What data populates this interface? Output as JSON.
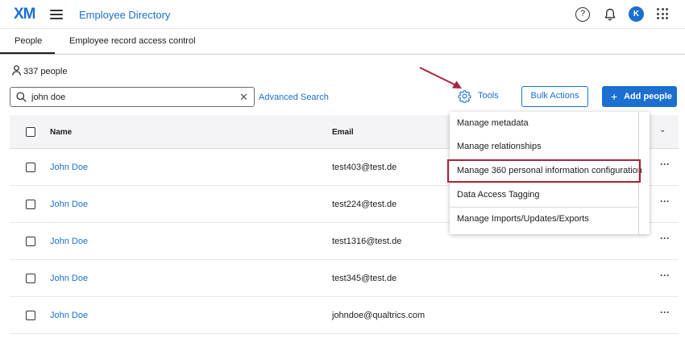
{
  "app": {
    "logo": "XM",
    "title": "Employee Directory",
    "avatar_initial": "K",
    "help_glyph": "?"
  },
  "tabs": [
    {
      "label": "People",
      "active": true
    },
    {
      "label": "Employee record access control",
      "active": false
    }
  ],
  "people_count": "337 people",
  "search": {
    "value": "john doe",
    "clear_glyph": "✕"
  },
  "advanced_search_label": "Advanced Search",
  "toolbar": {
    "tools_label": "Tools",
    "bulk_actions_label": "Bulk Actions",
    "add_people_label": "Add people",
    "add_glyph": "+"
  },
  "table": {
    "columns": {
      "name": "Name",
      "email": "Email",
      "chevron": "⌄"
    },
    "rows": [
      {
        "name": "John Doe",
        "email": "test403@test.de"
      },
      {
        "name": "John Doe",
        "email": "test224@test.de"
      },
      {
        "name": "John Doe",
        "email": "test1316@test.de"
      },
      {
        "name": "John Doe",
        "email": "test345@test.de"
      },
      {
        "name": "John Doe",
        "email": "johndoe@qualtrics.com"
      }
    ],
    "row_action_glyph": "···"
  },
  "tools_menu": {
    "items": [
      {
        "label": "Manage metadata"
      },
      {
        "label": "Manage relationships"
      },
      {
        "label": "Manage 360 personal information configuration",
        "highlighted": true
      },
      {
        "label": "Data Access Tagging"
      },
      {
        "label": "Manage Imports/Updates/Exports"
      }
    ]
  },
  "colors": {
    "accent": "#1a6fd0",
    "highlight": "#a7243a",
    "arrow": "#a7243a"
  }
}
